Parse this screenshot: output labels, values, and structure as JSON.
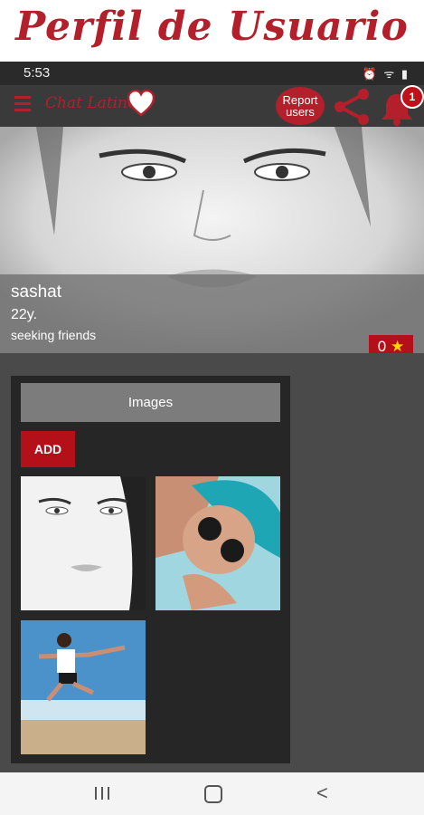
{
  "banner": {
    "title": "Perfil de Usuario"
  },
  "status": {
    "time": "5:53",
    "icons": "⏰ ᯤ ▮"
  },
  "appbar": {
    "logo_text": "Chat Latino",
    "report_label_1": "Report",
    "report_label_2": "users",
    "notification_count": "1",
    "icons": [
      "menu-icon",
      "heart-logo-icon",
      "share-icon",
      "bell-icon"
    ]
  },
  "profile": {
    "name": "sashat",
    "age": "22y.",
    "seeking": "seeking friends",
    "rating_value": "0",
    "rating_star": "★"
  },
  "gallery": {
    "section_label": "Images",
    "add_label": "ADD",
    "thumbnails": [
      "face-bw-photo",
      "blue-hair-sunglasses-photo",
      "beach-jump-photo"
    ]
  },
  "navbar": {
    "icons": [
      "recents-icon",
      "home-icon",
      "back-icon"
    ],
    "back_glyph": "<"
  },
  "colors": {
    "accent": "#b3202c",
    "panel": "#262626",
    "background": "#4a4a4a",
    "button_grey": "#7c7c7c"
  }
}
